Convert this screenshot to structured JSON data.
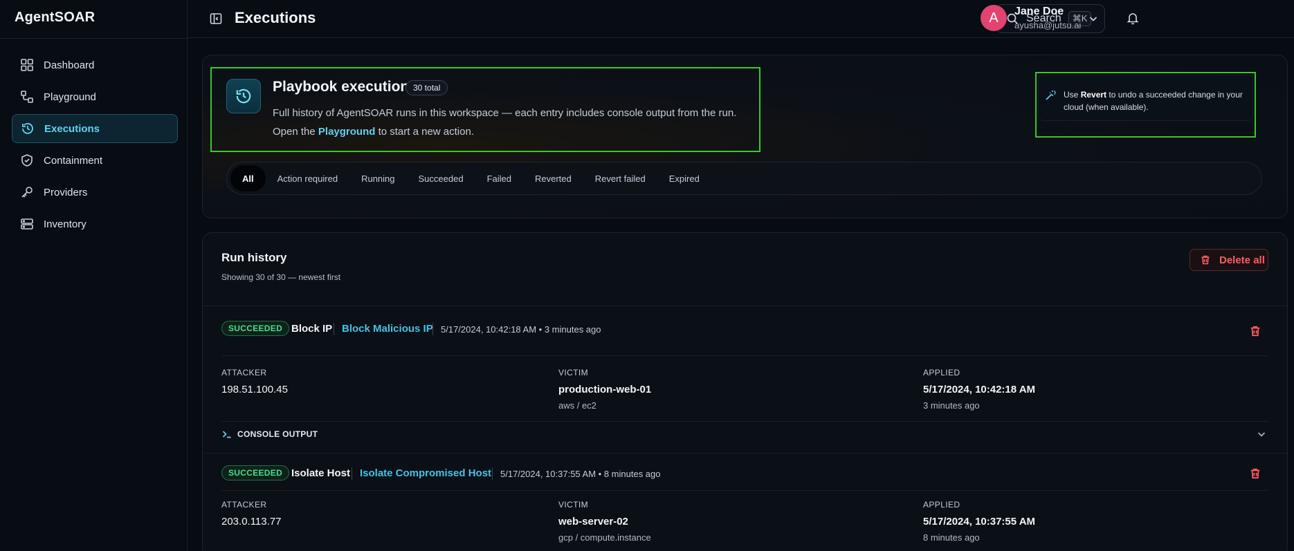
{
  "app": {
    "brand": "AgentSOAR"
  },
  "sidebar": {
    "items": [
      {
        "label": "Dashboard",
        "icon": "dashboard-icon"
      },
      {
        "label": "Playground",
        "icon": "playground-icon"
      },
      {
        "label": "Executions",
        "icon": "history-icon",
        "active": true
      },
      {
        "label": "Containment",
        "icon": "shield-icon"
      },
      {
        "label": "Providers",
        "icon": "key-icon"
      },
      {
        "label": "Inventory",
        "icon": "server-icon"
      }
    ]
  },
  "topbar": {
    "title": "Executions",
    "search_label": "Search",
    "search_shortcut": "⌘K",
    "user": {
      "initial": "A",
      "name": "Jane Doe",
      "email": "ayusha@jutsu.ai"
    }
  },
  "header": {
    "title": "Playbook executions",
    "total_badge": "30 total",
    "desc_before": "Full history of AgentSOAR runs in this workspace — each entry includes console output from the run. Open the ",
    "desc_link": "Playground",
    "desc_after": " to start a new action.",
    "revert_prefix": "Use ",
    "revert_bold": "Revert",
    "revert_suffix": " to undo a succeeded change in your cloud (when available)."
  },
  "filters": [
    "All",
    "Action required",
    "Running",
    "Succeeded",
    "Failed",
    "Reverted",
    "Revert failed",
    "Expired"
  ],
  "run_history": {
    "title": "Run history",
    "subtitle": "Showing 30 of 30 — newest first",
    "delete_all_label": "Delete all",
    "labels": {
      "attacker": "ATTACKER",
      "victim": "VICTIM",
      "applied": "APPLIED",
      "console": "CONSOLE OUTPUT"
    },
    "runs": [
      {
        "status": "SUCCEEDED",
        "action": "Block IP",
        "playbook": "Block Malicious IP",
        "time": "5/17/2024, 10:42:18 AM • 3 minutes ago",
        "attacker": "198.51.100.45",
        "victim": "production-web-01",
        "victim_sub": "aws / ec2",
        "applied": "5/17/2024, 10:42:18 AM",
        "applied_sub": "3 minutes ago"
      },
      {
        "status": "SUCCEEDED",
        "action": "Isolate Host",
        "playbook": "Isolate Compromised Host",
        "time": "5/17/2024, 10:37:55 AM • 8 minutes ago",
        "attacker": "203.0.113.77",
        "victim": "web-server-02",
        "victim_sub": "gcp / compute.instance",
        "applied": "5/17/2024, 10:37:55 AM",
        "applied_sub": "8 minutes ago"
      }
    ]
  },
  "colors": {
    "accent": "#5fd0ee",
    "success": "#4ddd8d",
    "danger": "#ff5d64",
    "avatar": "#e24370",
    "highlight_box": "#39c92a"
  }
}
